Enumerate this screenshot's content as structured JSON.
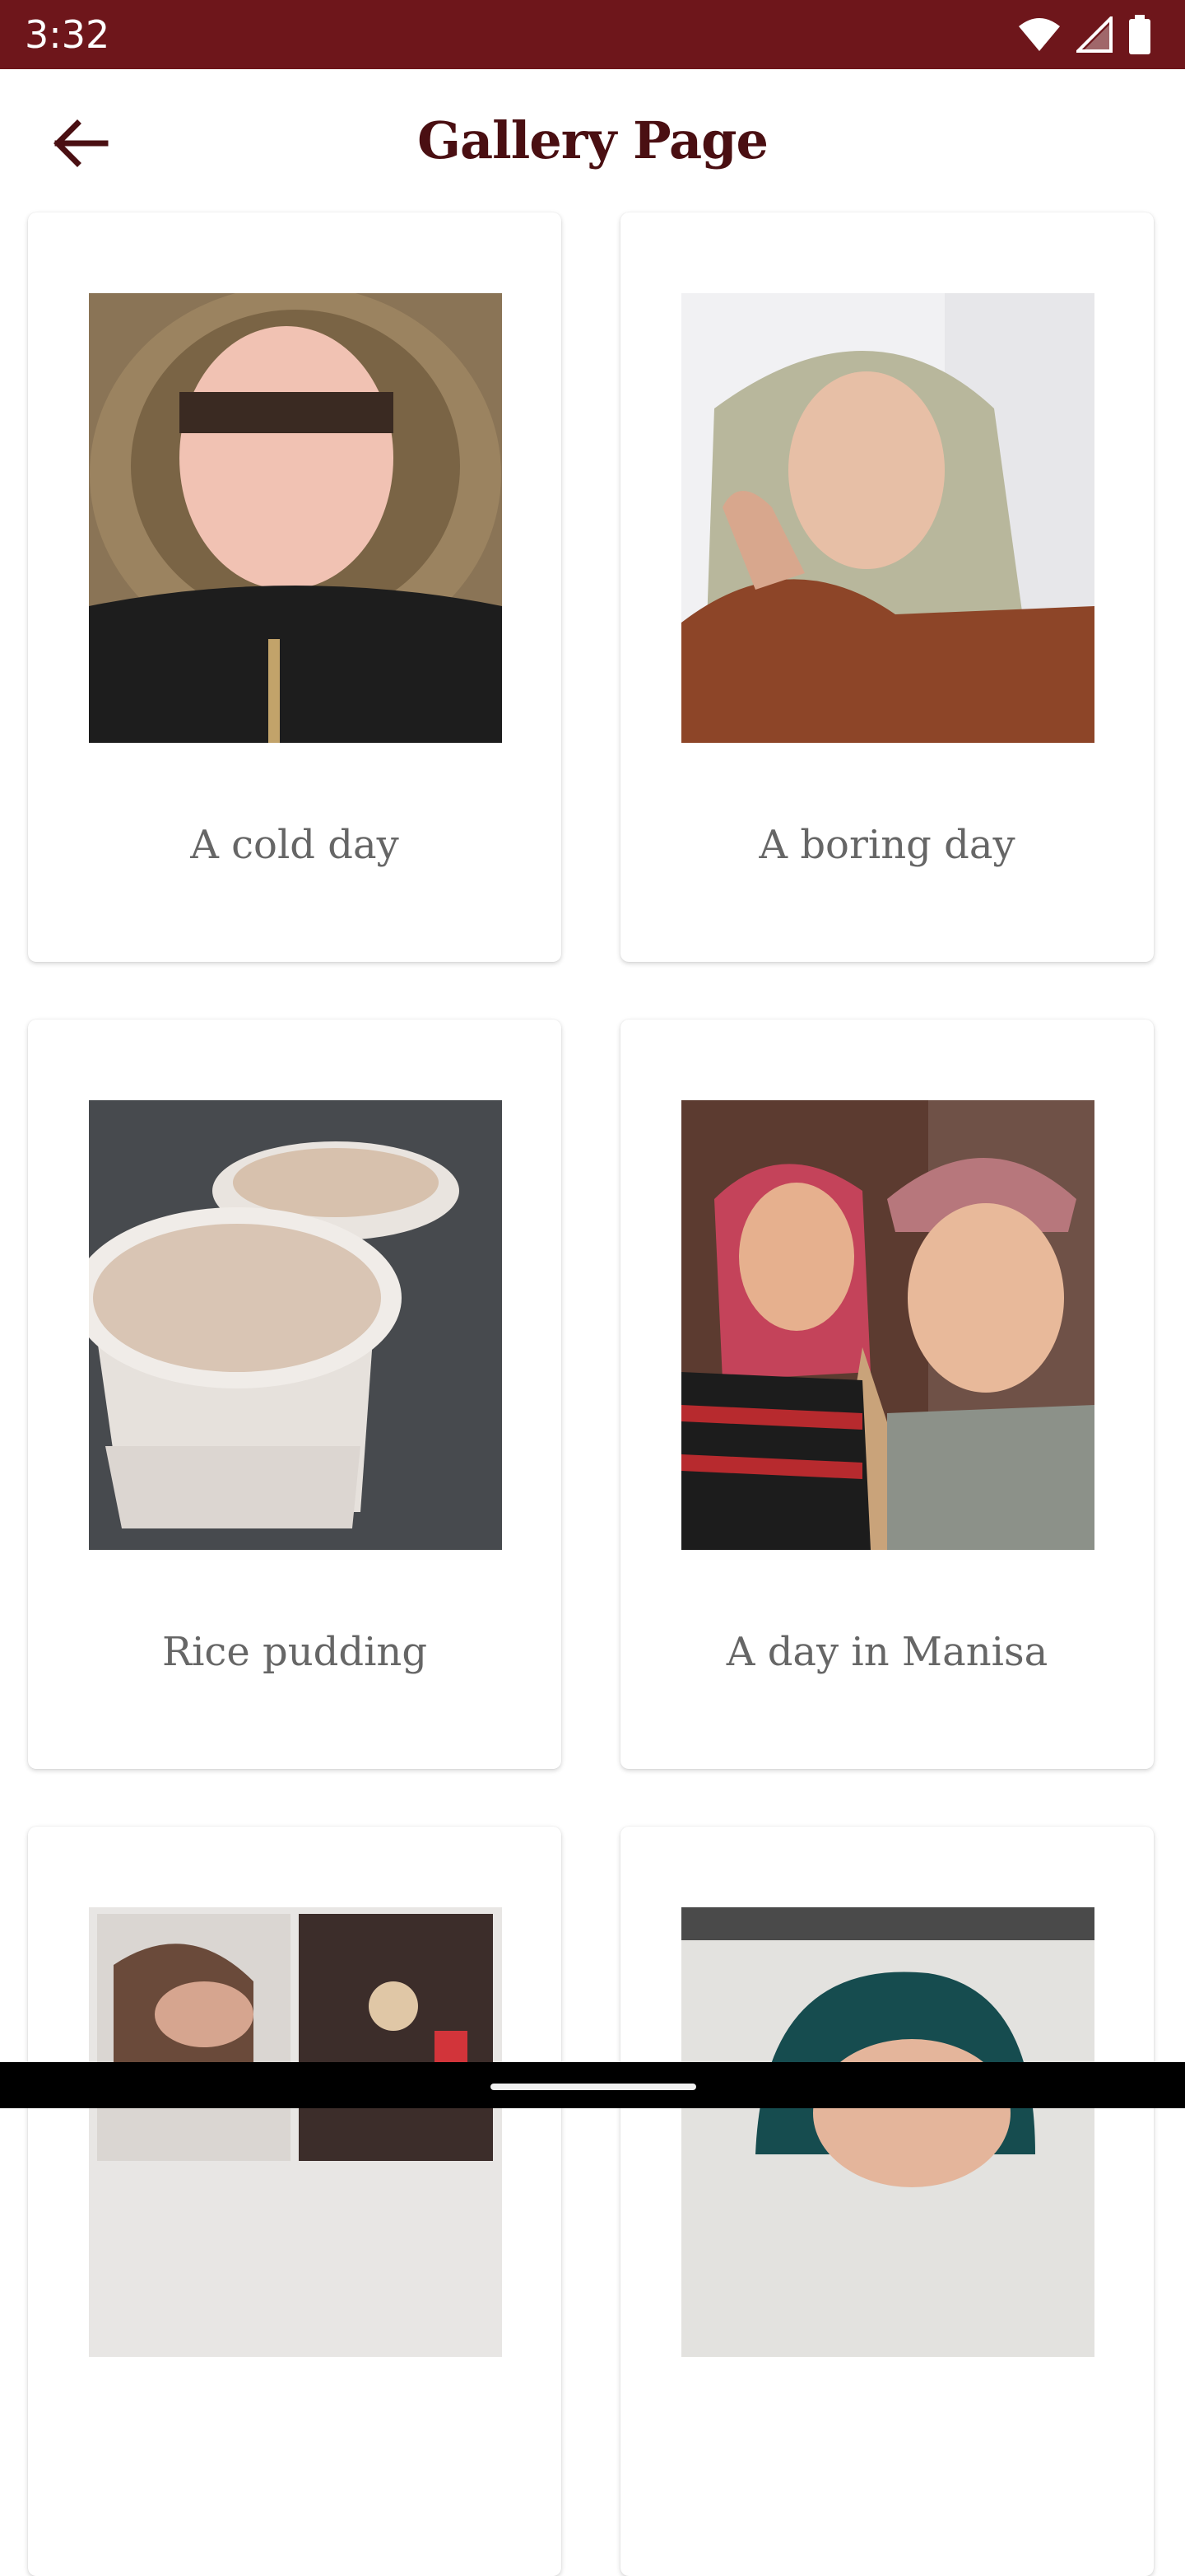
{
  "status": {
    "time": "3:32"
  },
  "header": {
    "title": "Gallery Page"
  },
  "gallery": [
    {
      "caption": "A cold day"
    },
    {
      "caption": "A boring day"
    },
    {
      "caption": "Rice pudding"
    },
    {
      "caption": "A day in Manisa"
    }
  ],
  "colors": {
    "statusbar": "#6e161b",
    "title": "#4a0f12",
    "caption": "#666666"
  }
}
